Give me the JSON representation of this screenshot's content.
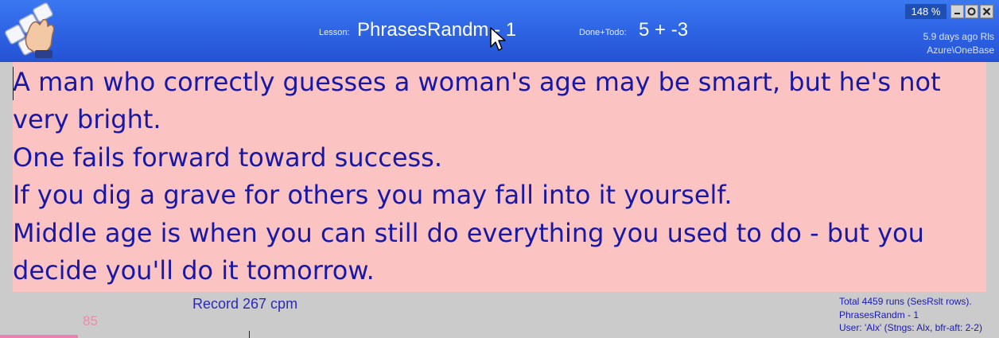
{
  "header": {
    "lesson_caption": "Lesson:",
    "lesson_value": "PhrasesRandm - 1",
    "done_caption": "Done+Todo:",
    "done_value": "5 + -3",
    "zoom": "148 %",
    "info_line1": "5.9 days ago Rls",
    "info_line2": "Azure\\OneBase"
  },
  "window_buttons": {
    "minimize_icon": "minimize-icon",
    "maximize_icon": "restore-icon",
    "close_icon": "close-icon"
  },
  "phrases": [
    "A man who correctly guesses a woman's age may be smart, but he's not very bright.",
    "One fails forward toward success.",
    "If you dig a grave for others you may fall into it yourself.",
    "Middle age is when you can still do everything you used to do - but you decide you'll do it tomorrow."
  ],
  "footer": {
    "record": "Record 267 cpm",
    "progress_value": "85",
    "progress_fraction": 0.245,
    "info_line1": "Total 4459 runs (SesRslt rows).",
    "info_line2": "PhrasesRandm - 1",
    "info_line3": "User: 'Alx' (Stngs: Alx,  bfr-aft: 2-2)"
  },
  "colors": {
    "header_bg": "#2f66e6",
    "text_area_bg": "#fcc3c3",
    "phrase_text": "#1818a6",
    "progress": "#ee7fb0"
  }
}
